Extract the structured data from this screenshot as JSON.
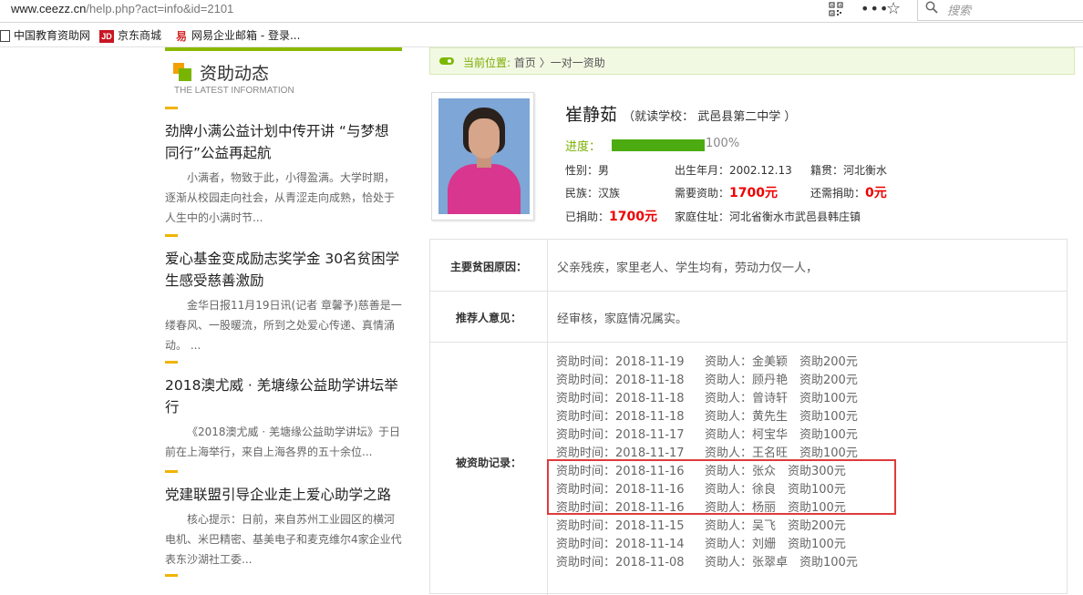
{
  "browser": {
    "url_domain": "www.ceezz.cn",
    "url_rest": "/help.php?act=info&id=2101",
    "search_placeholder": "搜索",
    "more_label": "•••",
    "star_icon": "star-icon",
    "qr_icon": "qr-code-icon"
  },
  "bookmarks": [
    {
      "label": "中国教育资助网",
      "icon": "page-icon"
    },
    {
      "label": "京东商城",
      "icon": "jd-icon",
      "icon_text": "JD"
    },
    {
      "label": "网易企业邮箱 - 登录...",
      "icon": "mail-icon",
      "icon_text": "易"
    }
  ],
  "sidebar": {
    "title": "资助动态",
    "subtitle": "THE LATEST INFORMATION",
    "news": [
      {
        "title": "劲牌小满公益计划中传开讲 “与梦想同行”公益再起航",
        "summary": "小满者，物致于此，小得盈满。大学时期，逐渐从校园走向社会，从青涩走向成熟，恰处于人生中的小满时节..."
      },
      {
        "title": "爱心基金变成励志奖学金 30名贫困学生感受慈善激励",
        "summary": "金华日报11月19日讯(记者 章馨予)慈善是一缕春风、一股暖流，所到之处爱心传递、真情涌动。 ..."
      },
      {
        "title": "2018澳尤威 · 羌塘缘公益助学讲坛举行",
        "summary": "《2018澳尤威 · 羌塘缘公益助学讲坛》于日前在上海举行，来自上海各界的五十余位..."
      },
      {
        "title": "党建联盟引导企业走上爱心助学之路",
        "summary": "核心提示：日前，来自苏州工业园区的横河电机、米巴精密、基美电子和麦克维尔4家企业代表东沙湖社工委..."
      }
    ]
  },
  "breadcrumb": {
    "label": "当前位置:",
    "path": "首页 〉一对一资助"
  },
  "student": {
    "name": "崔静茹",
    "school_text": "（就读学校： 武邑县第二中学 ）",
    "progress_label": "进度：",
    "progress_value": 1.0,
    "progress_text": "100%",
    "gender": "性别：男",
    "birth": "出生年月：2002.12.13",
    "native": "籍贯：河北衡水",
    "ethnicity": "民族：汉族",
    "need_label": "需要资助：",
    "need_value": "1700元",
    "still_need_label": "还需捐助：",
    "still_need_value": "0元",
    "donated_label": "已捐助：",
    "donated_value": "1700元",
    "address": "家庭住址：河北省衡水市武邑县韩庄镇"
  },
  "details": {
    "reason_label": "主要贫困原因：",
    "reason_value": "父亲残疾，家里老人、学生均有，劳动力仅一人，",
    "recommend_label": "推荐人意见：",
    "recommend_value": "经审核，家庭情况属实。",
    "records_label": "被资助记录："
  },
  "records": [
    {
      "time": "资助时间：2018-11-19",
      "donor": "资助人：金美颖　资助200元"
    },
    {
      "time": "资助时间：2018-11-18",
      "donor": "资助人：顾丹艳　资助200元"
    },
    {
      "time": "资助时间：2018-11-18",
      "donor": "资助人：曾诗轩　资助100元"
    },
    {
      "time": "资助时间：2018-11-18",
      "donor": "资助人：黄先生　资助100元"
    },
    {
      "time": "资助时间：2018-11-17",
      "donor": "资助人：柯宝华　资助100元"
    },
    {
      "time": "资助时间：2018-11-17",
      "donor": "资助人：王名旺　资助100元"
    },
    {
      "time": "资助时间：2018-11-16",
      "donor": "资助人：张众　资助300元"
    },
    {
      "time": "资助时间：2018-11-16",
      "donor": "资助人：徐良　资助100元"
    },
    {
      "time": "资助时间：2018-11-16",
      "donor": "资助人：杨丽　资助100元"
    },
    {
      "time": "资助时间：2018-11-15",
      "donor": "资助人：吴飞　资助200元"
    },
    {
      "time": "资助时间：2018-11-14",
      "donor": "资助人：刘姗　资助100元"
    },
    {
      "time": "资助时间：2018-11-08",
      "donor": "资助人：张翠卓　资助100元"
    }
  ],
  "colors": {
    "accent_green": "#7cb800",
    "progress_green": "#4cab10",
    "highlight_red": "#e03b3b",
    "money_red": "#ee0000",
    "news_bar": "#f0b400"
  }
}
